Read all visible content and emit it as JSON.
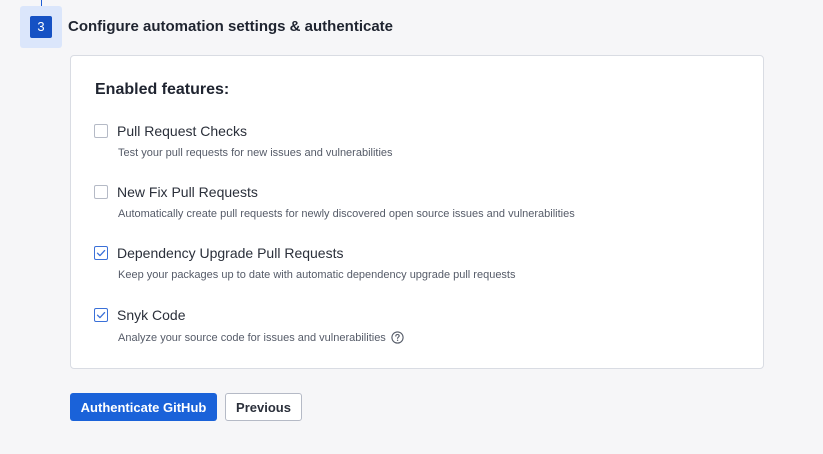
{
  "step": {
    "number": "3",
    "title": "Configure automation settings & authenticate"
  },
  "features": {
    "heading": "Enabled features:",
    "items": [
      {
        "label": "Pull Request Checks",
        "description": "Test your pull requests for new issues and vulnerabilities",
        "checked": false
      },
      {
        "label": "New Fix Pull Requests",
        "description": "Automatically create pull requests for newly discovered open source issues and vulnerabilities",
        "checked": false
      },
      {
        "label": "Dependency Upgrade Pull Requests",
        "description": "Keep your packages up to date with automatic dependency upgrade pull requests",
        "checked": true
      },
      {
        "label": "Snyk Code",
        "description": "Analyze your source code for issues and vulnerabilities",
        "checked": true,
        "icon": "help-icon"
      }
    ]
  },
  "actions": {
    "authenticate_label": "Authenticate GitHub",
    "previous_label": "Previous"
  },
  "colors": {
    "primary": "#1a62d9",
    "step_badge_bg": "#dbe6fb",
    "step_num_bg": "#1551c4"
  }
}
